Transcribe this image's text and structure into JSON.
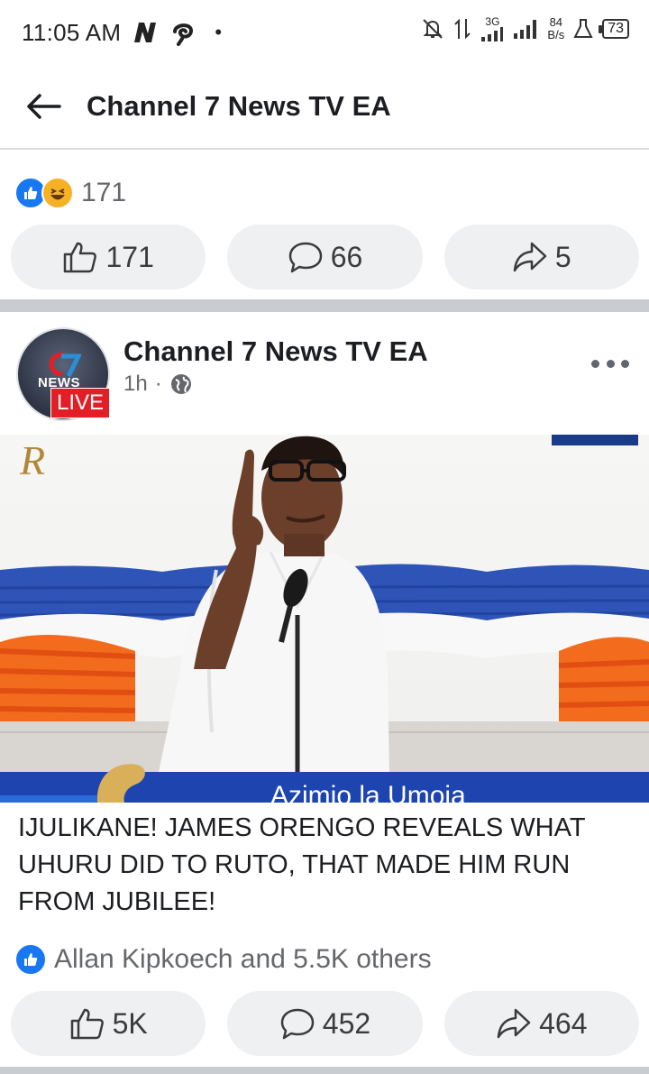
{
  "status_bar": {
    "time": "11:05 AM",
    "network": "3G",
    "speed_value": "84",
    "speed_unit": "B/s",
    "battery": "73"
  },
  "header": {
    "title": "Channel 7 News TV EA"
  },
  "previous_post": {
    "reaction_count": "171",
    "like_count": "171",
    "comment_count": "66",
    "share_count": "5"
  },
  "post": {
    "page_name": "Channel 7 News TV EA",
    "time": "1h",
    "avatar_text": "NEWS",
    "live_label": "LIVE",
    "video_banner": "Azimio la Umoja",
    "caption": "IJULIKANE! JAMES ORENGO REVEALS WHAT UHURU DID TO RUTO, THAT MADE HIM RUN FROM JUBILEE!",
    "reactions_text": "Allan Kipkoech and 5.5K others",
    "like_count": "5K",
    "comment_count": "452",
    "share_count": "464"
  },
  "colors": {
    "facebook_blue": "#1877f2",
    "live_red": "#e41e26",
    "button_bg": "#eef0f2"
  }
}
